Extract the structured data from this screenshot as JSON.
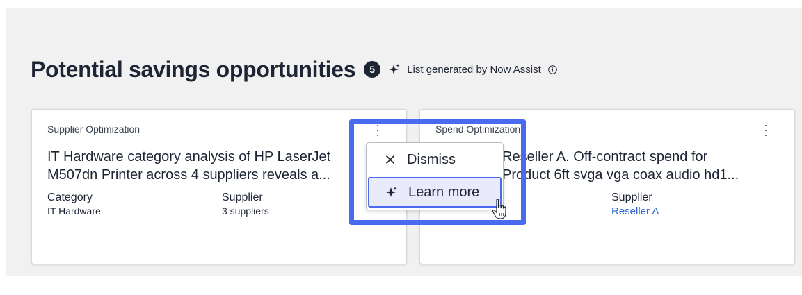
{
  "header": {
    "title": "Potential savings opportunities",
    "count": "5",
    "generated_label": "List generated by Now Assist",
    "sparkle_icon": "sparkle-icon",
    "info_icon": "info-circle-icon"
  },
  "cards": [
    {
      "kicker": "Supplier Optimization",
      "body_line1": "IT Hardware category analysis of HP LaserJet",
      "body_line2": "M507dn Printer across 4 suppliers reveals a...",
      "meta": [
        {
          "label": "Category",
          "value": "IT Hardware"
        },
        {
          "label": "Supplier",
          "value": "3 suppliers"
        }
      ]
    },
    {
      "kicker": "Spend Optimization",
      "body_line1": "Reseller A. Off-contract spend for",
      "body_line2": "Product 6ft svga vga coax audio hd1...",
      "meta": [
        {
          "label": "Supplier",
          "value": "Reseller A"
        }
      ]
    }
  ],
  "menu": {
    "dismiss_label": "Dismiss",
    "learn_more_label": "Learn more",
    "dismiss_icon": "close-icon",
    "learn_more_icon": "sparkle-icon"
  },
  "colors": {
    "accent": "#4a6af0",
    "link": "#2c63d6",
    "badge": "#1d2433",
    "panel_bg": "#f1f1f2",
    "menu_highlight": "#e9ebfb"
  }
}
